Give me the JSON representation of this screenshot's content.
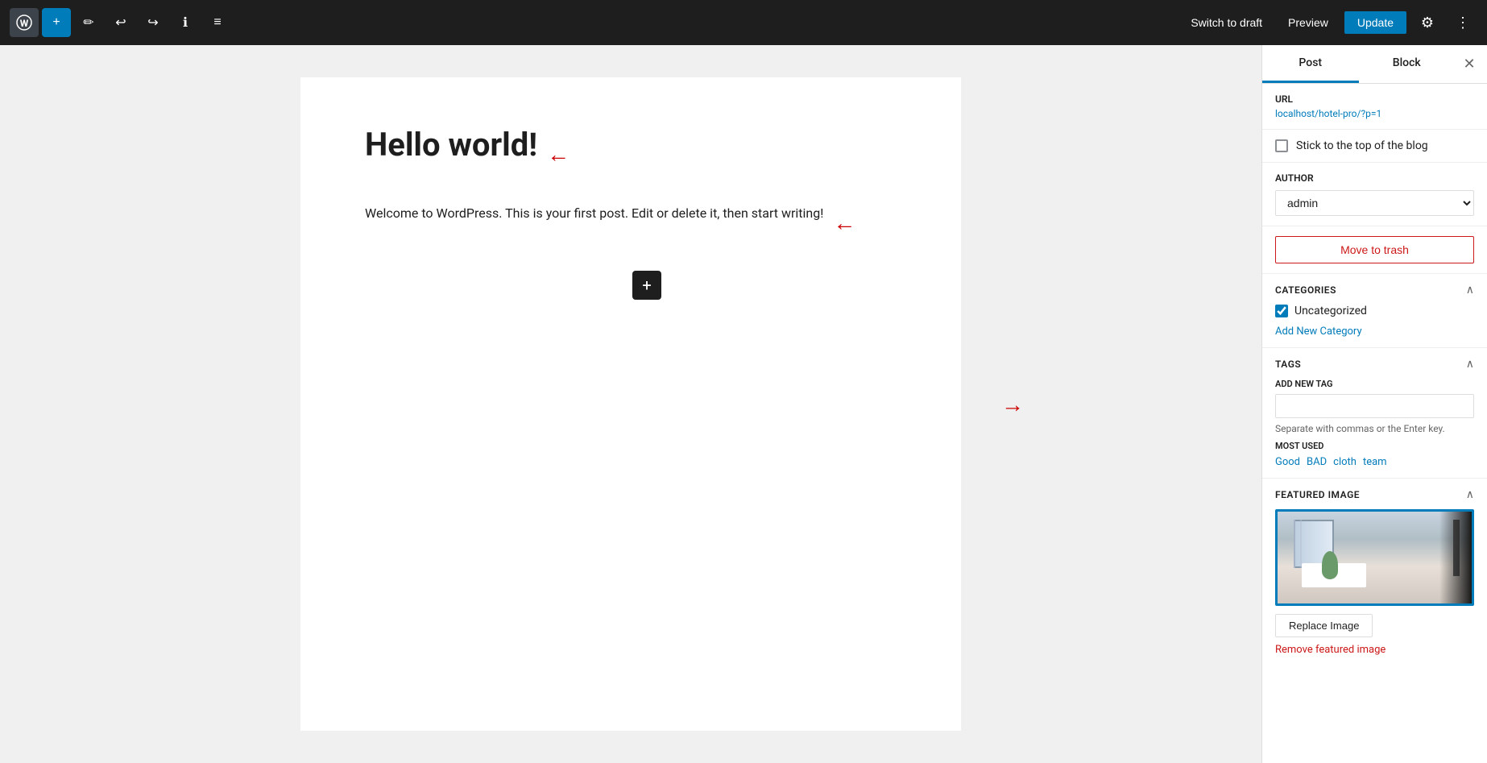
{
  "toolbar": {
    "wp_logo": "W",
    "add_label": "+",
    "edit_label": "✏",
    "undo_label": "↩",
    "redo_label": "↪",
    "info_label": "ℹ",
    "list_view_label": "≡",
    "switch_to_draft": "Switch to draft",
    "preview": "Preview",
    "update": "Update",
    "settings_icon": "⚙",
    "more_icon": "⋮"
  },
  "editor": {
    "post_title": "Hello world!",
    "post_body": "Welcome to WordPress. This is your first post. Edit or delete it, then start writing!",
    "add_block_label": "+"
  },
  "sidebar": {
    "post_tab": "Post",
    "block_tab": "Block",
    "close_icon": "✕",
    "url_label": "URL",
    "url_value": "localhost/hotel-pro/?p=1",
    "stick_to_top": "Stick to the top of the blog",
    "author_label": "AUTHOR",
    "author_value": "admin",
    "author_options": [
      "admin"
    ],
    "trash_button": "Move to trash",
    "categories_title": "Categories",
    "category_items": [
      {
        "label": "Uncategorized",
        "checked": true
      }
    ],
    "add_category_label": "Add New Category",
    "tags_title": "Tags",
    "add_new_tag_label": "ADD NEW TAG",
    "tag_input_placeholder": "",
    "tag_hint": "Separate with commas or the Enter key.",
    "most_used_label": "MOST USED",
    "tag_links": [
      "Good",
      "BAD",
      "cloth",
      "team"
    ],
    "featured_image_title": "Featured image",
    "replace_image_label": "Replace Image",
    "remove_image_label": "Remove featured image"
  },
  "arrows": {
    "title_arrow": "←",
    "body_arrow": "←",
    "sidebar_arrow": "←"
  },
  "colors": {
    "accent": "#007cba",
    "trash": "#cc1818",
    "toolbar_bg": "#1e1e1e",
    "arrow_red": "#cc0000"
  }
}
